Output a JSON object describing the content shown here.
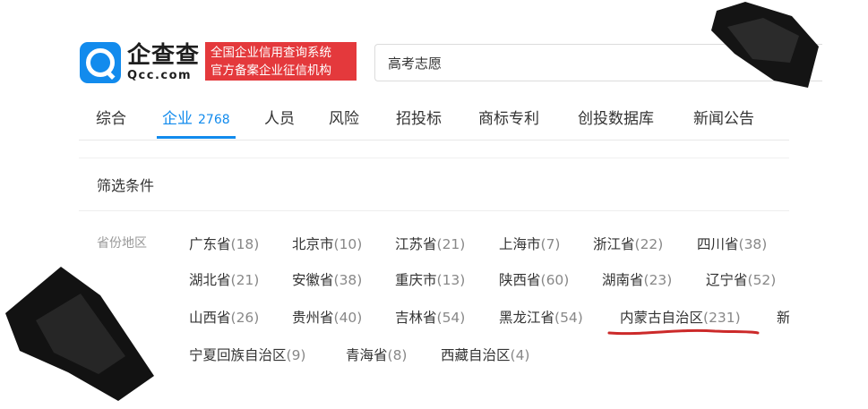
{
  "header": {
    "brand_cn": "企查查",
    "brand_en": "Qcc.com",
    "slogan_line1": "全国企业信用查询系统",
    "slogan_line2": "官方备案企业征信机构",
    "search_value": "高考志愿"
  },
  "tabs": [
    {
      "label": "综合"
    },
    {
      "label": "企业",
      "count": "2768"
    },
    {
      "label": "人员"
    },
    {
      "label": "风险"
    },
    {
      "label": "招投标"
    },
    {
      "label": "商标专利"
    },
    {
      "label": "创投数据库"
    },
    {
      "label": "新闻公告"
    }
  ],
  "filter": {
    "title": "筛选条件",
    "province_label": "省份地区",
    "options": [
      {
        "name": "广东省",
        "count": "(18)"
      },
      {
        "name": "北京市",
        "count": "(10)"
      },
      {
        "name": "江苏省",
        "count": "(21)"
      },
      {
        "name": "上海市",
        "count": "(7)"
      },
      {
        "name": "浙江省",
        "count": "(22)"
      },
      {
        "name": "四川省",
        "count": "(38)"
      },
      {
        "name": "湖北省",
        "count": "(21)"
      },
      {
        "name": "安徽省",
        "count": "(38)"
      },
      {
        "name": "重庆市",
        "count": "(13)"
      },
      {
        "name": "陕西省",
        "count": "(60)"
      },
      {
        "name": "湖南省",
        "count": "(23)"
      },
      {
        "name": "辽宁省",
        "count": "(52)"
      },
      {
        "name": "山西省",
        "count": "(26)"
      },
      {
        "name": "贵州省",
        "count": "(40)"
      },
      {
        "name": "吉林省",
        "count": "(54)"
      },
      {
        "name": "黑龙江省",
        "count": "(54)"
      },
      {
        "name": "内蒙古自治区",
        "count": "(231)"
      },
      {
        "name": "新",
        "count": ""
      },
      {
        "name": "宁夏回族自治区",
        "count": "(9)"
      },
      {
        "name": "青海省",
        "count": "(8)"
      },
      {
        "name": "西藏自治区",
        "count": "(4)"
      }
    ]
  },
  "colors": {
    "accent": "#128bed",
    "slogan_bg": "#e4393c",
    "highlight_underline": "#cc2a2a"
  }
}
